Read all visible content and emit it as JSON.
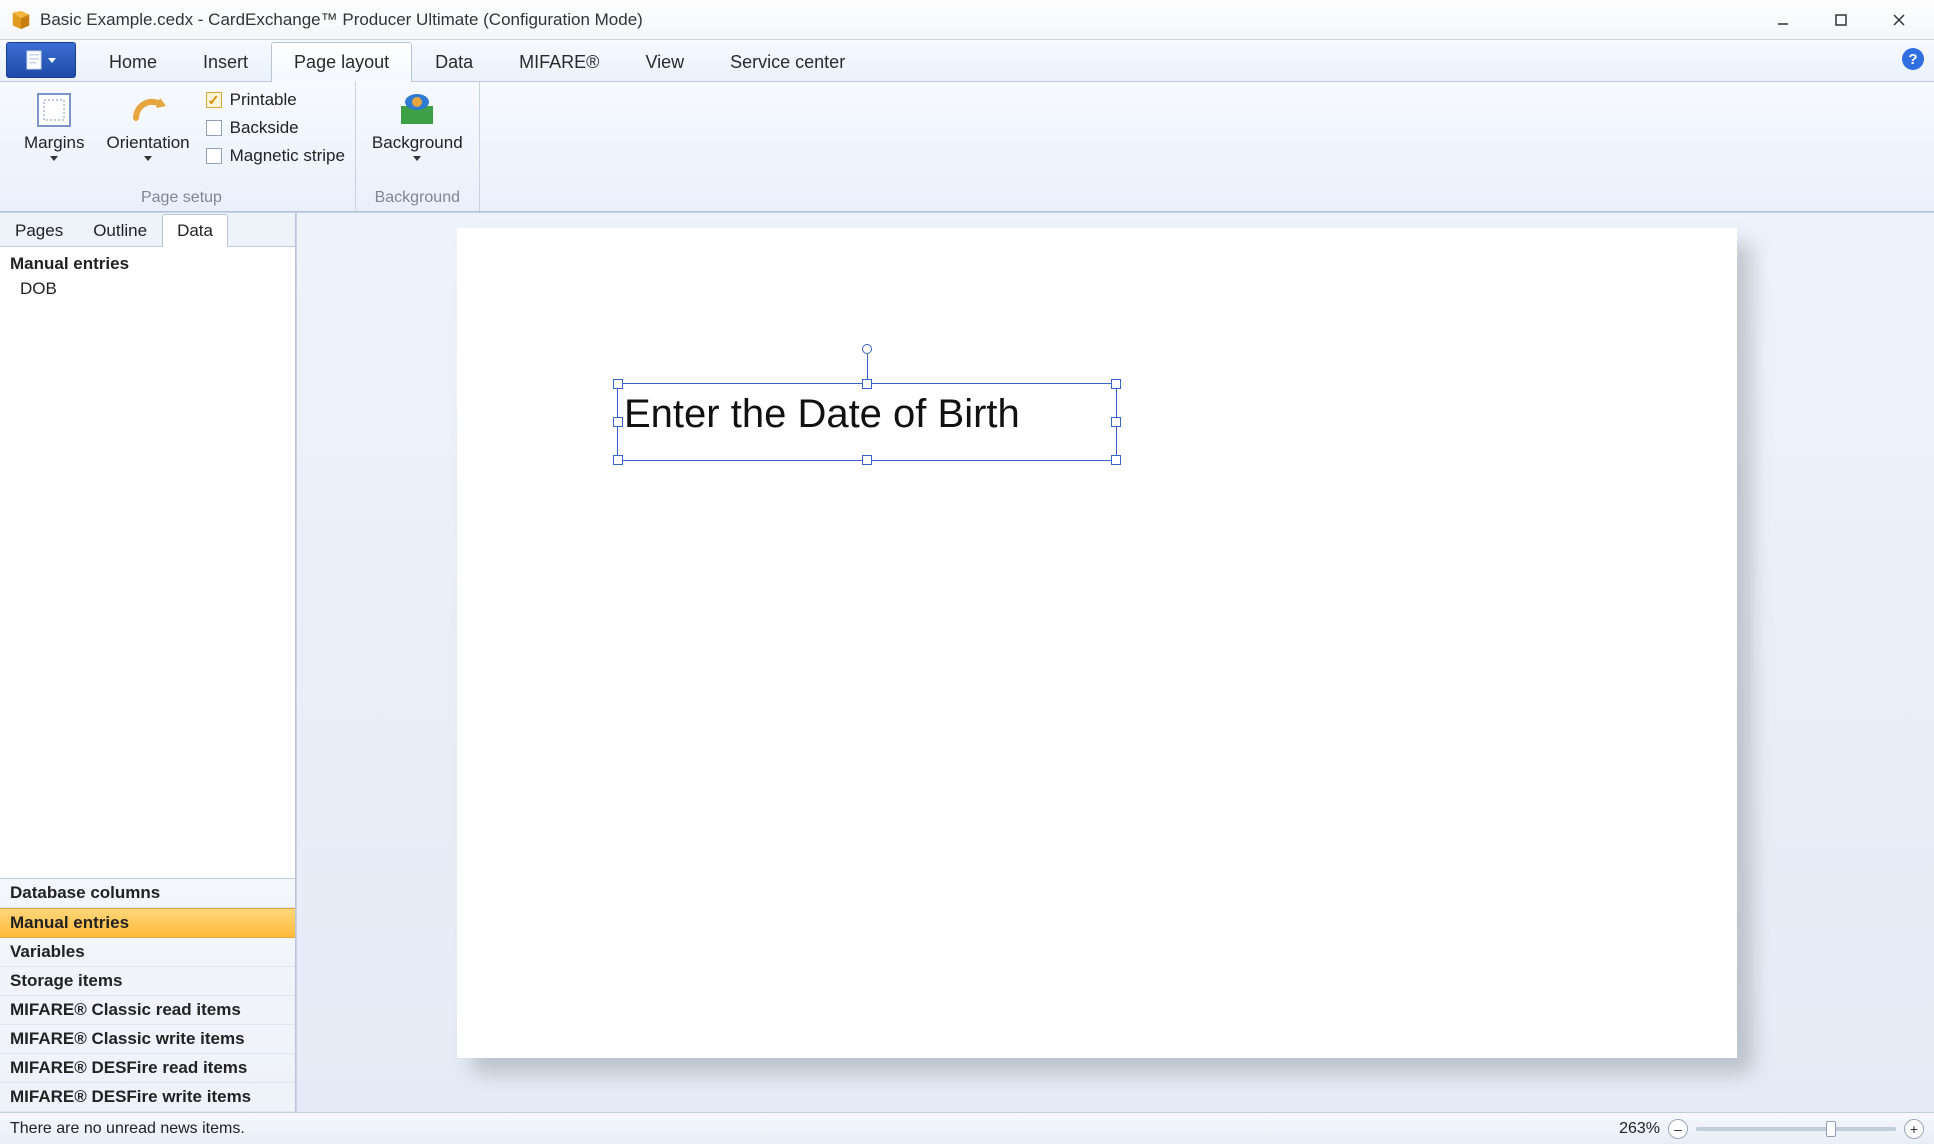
{
  "window": {
    "title": "Basic Example.cedx - CardExchange™ Producer Ultimate (Configuration Mode)"
  },
  "ribbon": {
    "tabs": [
      "Home",
      "Insert",
      "Page layout",
      "Data",
      "MIFARE®",
      "View",
      "Service center"
    ],
    "active_tab": "Page layout",
    "groups": {
      "page_setup": {
        "label": "Page setup",
        "margins": "Margins",
        "orientation": "Orientation",
        "printable": "Printable",
        "backside": "Backside",
        "magstripe": "Magnetic stripe"
      },
      "background": {
        "label": "Background",
        "button": "Background"
      }
    }
  },
  "left_panel": {
    "tabs": [
      "Pages",
      "Outline",
      "Data"
    ],
    "active_tab": "Data",
    "section_title": "Manual entries",
    "items": [
      "DOB"
    ],
    "categories": [
      "Database columns",
      "Manual entries",
      "Variables",
      "Storage items",
      "MIFARE® Classic read items",
      "MIFARE® Classic write items",
      "MIFARE® DESFire read items",
      "MIFARE® DESFire write items"
    ],
    "selected_category": "Manual entries"
  },
  "canvas": {
    "selected_text": "Enter the Date of Birth"
  },
  "statusbar": {
    "news": "There are no unread news items.",
    "zoom": "263%"
  }
}
